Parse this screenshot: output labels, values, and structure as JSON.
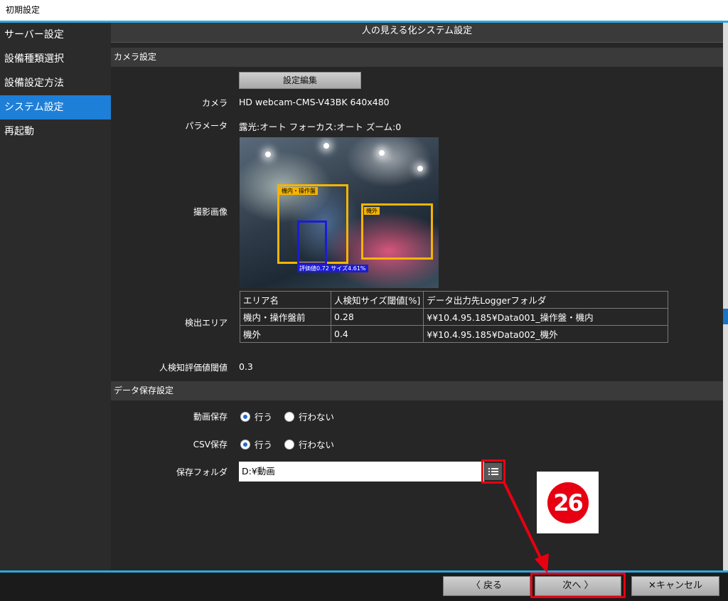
{
  "window": {
    "title": "初期設定"
  },
  "sidebar": {
    "items": [
      {
        "label": "サーバー設定",
        "active": false
      },
      {
        "label": "設備種類選択",
        "active": false
      },
      {
        "label": "設備設定方法",
        "active": false
      },
      {
        "label": "システム設定",
        "active": true
      },
      {
        "label": "再起動",
        "active": false
      }
    ]
  },
  "main": {
    "title": "人の見える化システム設定",
    "camera_section": {
      "title": "カメラ設定",
      "edit_button": "設定編集",
      "camera_label": "カメラ",
      "camera_value": "HD webcam-CMS-V43BK 640x480",
      "param_label": "パラメータ",
      "param_value": "露光:オート フォーカス:オート ズーム:0",
      "image_label": "撮影画像",
      "overlays": {
        "zone1_tag": "機内・操作盤",
        "zone2_tag": "機外",
        "detection_tag": "評価値0.72 サイズ4.61%"
      },
      "area_label": "検出エリア",
      "table": {
        "headers": [
          "エリア名",
          "人検知サイズ閾値[%]",
          "データ出力先Loggerフォルダ"
        ],
        "rows": [
          [
            "機内・操作盤前",
            "0.28",
            "¥¥10.4.95.185¥Data001_操作盤・機内"
          ],
          [
            "機外",
            "0.4",
            "¥¥10.4.95.185¥Data002_機外"
          ]
        ]
      },
      "threshold_label": "人検知評価値閾値",
      "threshold_value": "0.3"
    },
    "data_section": {
      "title": "データ保存設定",
      "video_label": "動画保存",
      "csv_label": "CSV保存",
      "option_yes": "行う",
      "option_no": "行わない",
      "video_selected": "yes",
      "csv_selected": "yes",
      "folder_label": "保存フォルダ",
      "folder_value": "D:¥動画"
    }
  },
  "annotation": {
    "step": "26",
    "color": "#e60012"
  },
  "footer": {
    "back": "〈 戻る",
    "next": "次へ 〉",
    "cancel": "✕キャンセル"
  },
  "colors": {
    "accent": "#29a9e1",
    "active": "#1e7fd8",
    "highlight": "#e60012"
  }
}
